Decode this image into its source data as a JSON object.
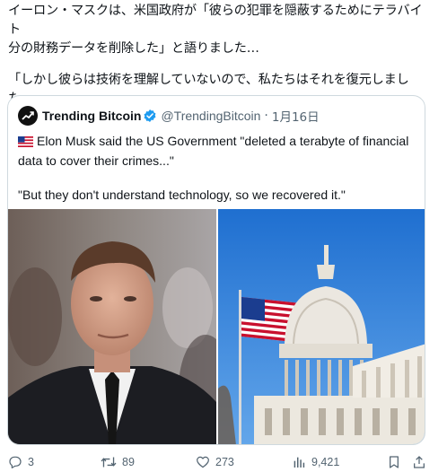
{
  "post": {
    "line1": "イーロン・マスクは、米国政府が「彼らの犯罪を隠蔽するためにテラバイト",
    "line2": "分の財務データを削除した」と語りました…",
    "line3": "「しかし彼らは技術を理解していないので、私たちはそれを復元しまし",
    "line4": "た。」"
  },
  "quote": {
    "name": "Trending Bitcoin",
    "handle": "@TrendingBitcoin",
    "separator": "·",
    "date": "1月16日",
    "line1": "Elon Musk said the US Government \"deleted a terabyte of financial",
    "line2": "data to cover their crimes...\"",
    "line3": "\"But they don't understand technology, so we recovered it.\"",
    "flag_icon": "us-flag-emoji",
    "verified_color": "#1d9bf0"
  },
  "actions": {
    "replies": "3",
    "reposts": "89",
    "likes": "273",
    "views": "9,421"
  },
  "colors": {
    "text": "#0f1419",
    "muted": "#536471",
    "border": "#cfd9de",
    "sky": "#2f7fd6"
  }
}
